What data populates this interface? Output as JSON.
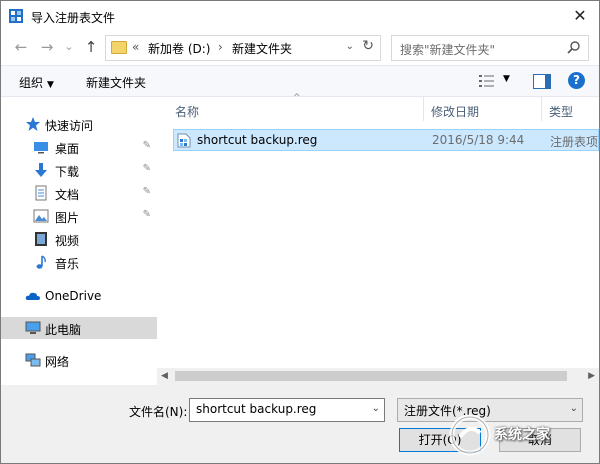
{
  "window": {
    "title": "导入注册表文件",
    "close_glyph": "✕"
  },
  "address": {
    "back_glyph": "←",
    "forward_glyph": "→",
    "recent_glyph": "⌄",
    "up_glyph": "↑",
    "overflow": "«",
    "segments": [
      "新加卷 (D:)",
      "新建文件夹"
    ],
    "separator": "›",
    "dropdown_glyph": "⌄",
    "refresh_glyph": "↻"
  },
  "search": {
    "placeholder": "搜索\"新建文件夹\""
  },
  "toolbar": {
    "organize_label": "组织",
    "organize_caret": "▼",
    "new_folder_label": "新建文件夹",
    "view_caret": "▼",
    "help_label": "?"
  },
  "sidebar": {
    "quick_access": {
      "label": "快速访问",
      "icon": "star-icon"
    },
    "items": [
      {
        "label": "桌面",
        "icon": "desktop-icon",
        "pinned": true
      },
      {
        "label": "下载",
        "icon": "download-icon",
        "pinned": true
      },
      {
        "label": "文档",
        "icon": "document-icon",
        "pinned": true
      },
      {
        "label": "图片",
        "icon": "picture-icon",
        "pinned": true
      },
      {
        "label": "视频",
        "icon": "video-icon",
        "pinned": false
      },
      {
        "label": "音乐",
        "icon": "music-icon",
        "pinned": false
      }
    ],
    "onedrive": {
      "label": "OneDrive",
      "icon": "cloud-icon"
    },
    "this_pc": {
      "label": "此电脑",
      "icon": "computer-icon",
      "selected": true
    },
    "network": {
      "label": "网络",
      "icon": "network-icon"
    },
    "pin_glyph": "📌"
  },
  "columns": {
    "name": "名称",
    "date": "修改日期",
    "type": "类型",
    "sort_glyph": "^"
  },
  "files": [
    {
      "name": "shortcut backup.reg",
      "modified": "2016/5/18 9:44",
      "type": "注册表项",
      "selected": true
    }
  ],
  "scrollbar": {
    "left_glyph": "◀",
    "right_glyph": "▶"
  },
  "footer": {
    "filename_label": "文件名(N):",
    "filename_value": "shortcut backup.reg",
    "filename_dd": "⌄",
    "filetype_value": "注册文件(*.reg)",
    "filetype_dd": "⌄",
    "open_label": "打开(O)",
    "cancel_label": "取消"
  },
  "watermark": {
    "text": "系统之家"
  },
  "colors": {
    "accent": "#0078d7",
    "selection": "#cce8ff",
    "selection_border": "#99d1ff",
    "toolbar_bg": "#f6f8fb",
    "footer_bg": "#f0f0f0"
  }
}
